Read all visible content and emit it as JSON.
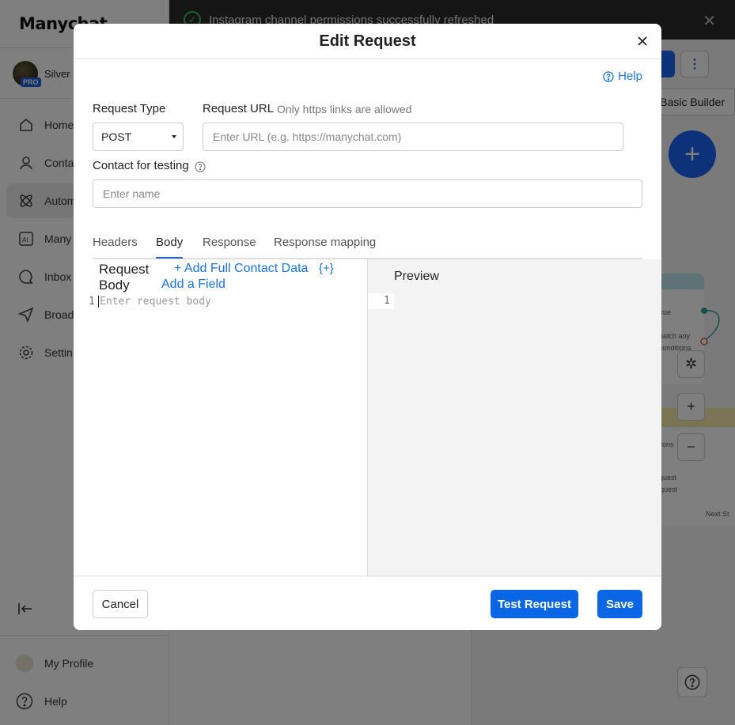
{
  "background": {
    "logo": "Manychat",
    "account_name": "Silver C",
    "pro_badge": "PRO",
    "nav": [
      "Home",
      "Conta",
      "Autom",
      "Many",
      "Inbox",
      "Broad",
      "Settin"
    ],
    "bottom_nav": [
      "My Profile",
      "Help"
    ],
    "toast": "Instagram channel permissions successfully refreshed",
    "basic_builder": "Basic Builder",
    "node_lines": [
      "rue",
      "natch any",
      "conditions"
    ],
    "card_lines": [
      "ions",
      "quest",
      "equest",
      "Next St"
    ]
  },
  "modal": {
    "title": "Edit Request",
    "help": "Help",
    "request_type_label": "Request Type",
    "request_type_value": "POST",
    "request_url_label": "Request URL",
    "request_url_hint": "Only https links are allowed",
    "url_placeholder": "Enter URL (e.g. https://manychat.com)",
    "contact_label": "Contact for testing",
    "contact_placeholder": "Enter name",
    "tabs": [
      "Headers",
      "Body",
      "Response",
      "Response mapping"
    ],
    "active_tab": "Body",
    "body_title": "Request Body",
    "add_full_contact": "+ Add Full Contact Data",
    "add_field": "Add a Field",
    "field_token": "{+}",
    "line_number": "1",
    "body_placeholder": "Enter request body",
    "preview_title": "Preview",
    "cancel": "Cancel",
    "test_request": "Test Request",
    "save": "Save"
  },
  "colors": {
    "accent": "#0a66e4",
    "link": "#1a73e8",
    "overlay": "rgba(0,0,0,0.5)"
  }
}
